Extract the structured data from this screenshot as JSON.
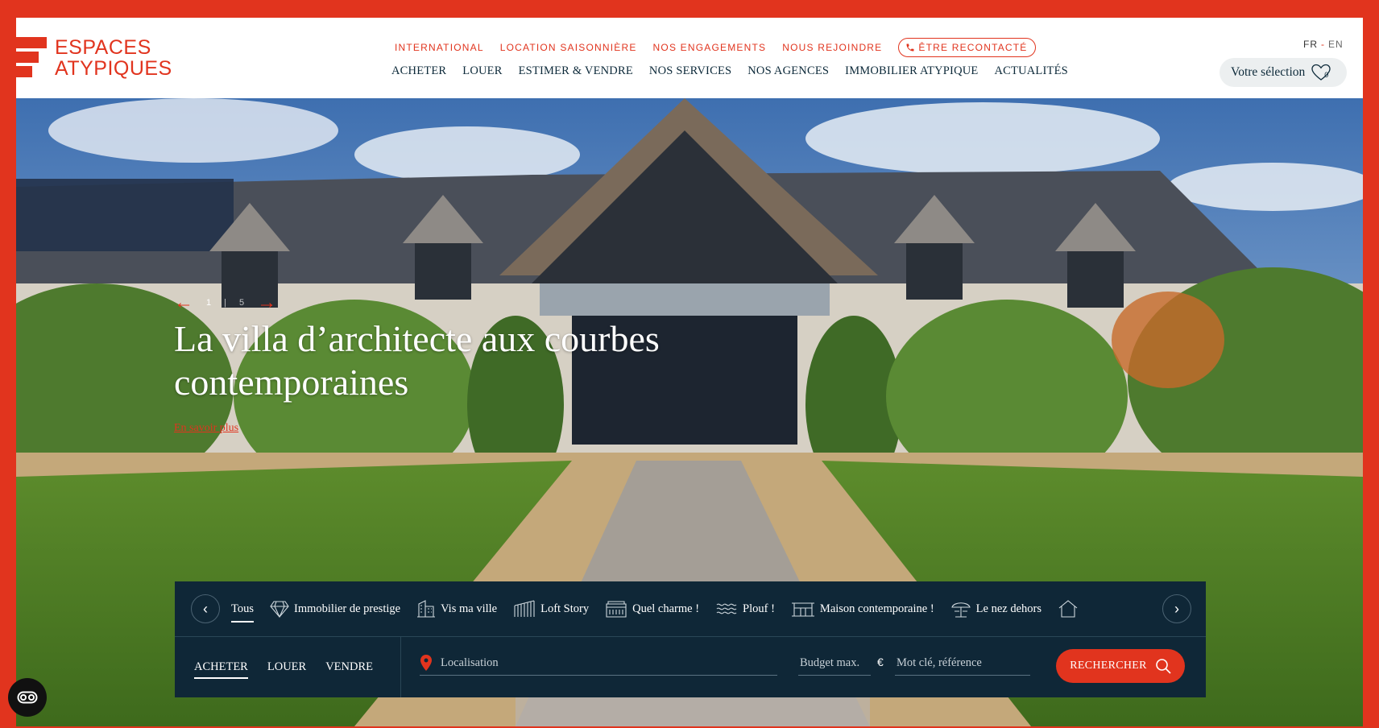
{
  "brand": {
    "logo_line1": "ESPACES",
    "logo_line2": "ATYPIQUES",
    "color": "#e1341e"
  },
  "topnav": {
    "international": "INTERNATIONAL",
    "location": "LOCATION SAISONNIÈRE",
    "engagements": "NOS ENGAGEMENTS",
    "rejoindre": "NOUS REJOINDRE",
    "recontacte": "ÊTRE RECONTACTÉ"
  },
  "mainnav": {
    "acheter": "ACHETER",
    "louer": "LOUER",
    "estimer": "ESTIMER & VENDRE",
    "services": "NOS SERVICES",
    "agences": "NOS AGENCES",
    "immobilier": "IMMOBILIER ATYPIQUE",
    "actualites": "ACTUALITÉS"
  },
  "lang": {
    "fr": "FR",
    "sep": "-",
    "en": "EN"
  },
  "selection": {
    "label": "Votre sélection",
    "count": "0"
  },
  "hero": {
    "current": "1",
    "total": "5",
    "title": "La villa d’architecte aux courbes contemporaines",
    "link": "En savoir plus"
  },
  "categories": {
    "items": [
      {
        "label": "Tous",
        "icon": "none"
      },
      {
        "label": "Immobilier de prestige",
        "icon": "diamond-icon"
      },
      {
        "label": "Vis ma ville",
        "icon": "building-icon"
      },
      {
        "label": "Loft Story",
        "icon": "loft-icon"
      },
      {
        "label": "Quel charme !",
        "icon": "house-charm-icon"
      },
      {
        "label": "Plouf !",
        "icon": "water-icon"
      },
      {
        "label": "Maison contemporaine !",
        "icon": "contemporary-house-icon"
      },
      {
        "label": "Le nez dehors",
        "icon": "outdoor-icon"
      }
    ]
  },
  "search": {
    "modes": [
      "ACHETER",
      "LOUER",
      "VENDRE"
    ],
    "location_placeholder": "Localisation",
    "budget_placeholder": "Budget max.",
    "currency": "€",
    "keyword_placeholder": "Mot clé, référence",
    "button": "RECHERCHER"
  }
}
